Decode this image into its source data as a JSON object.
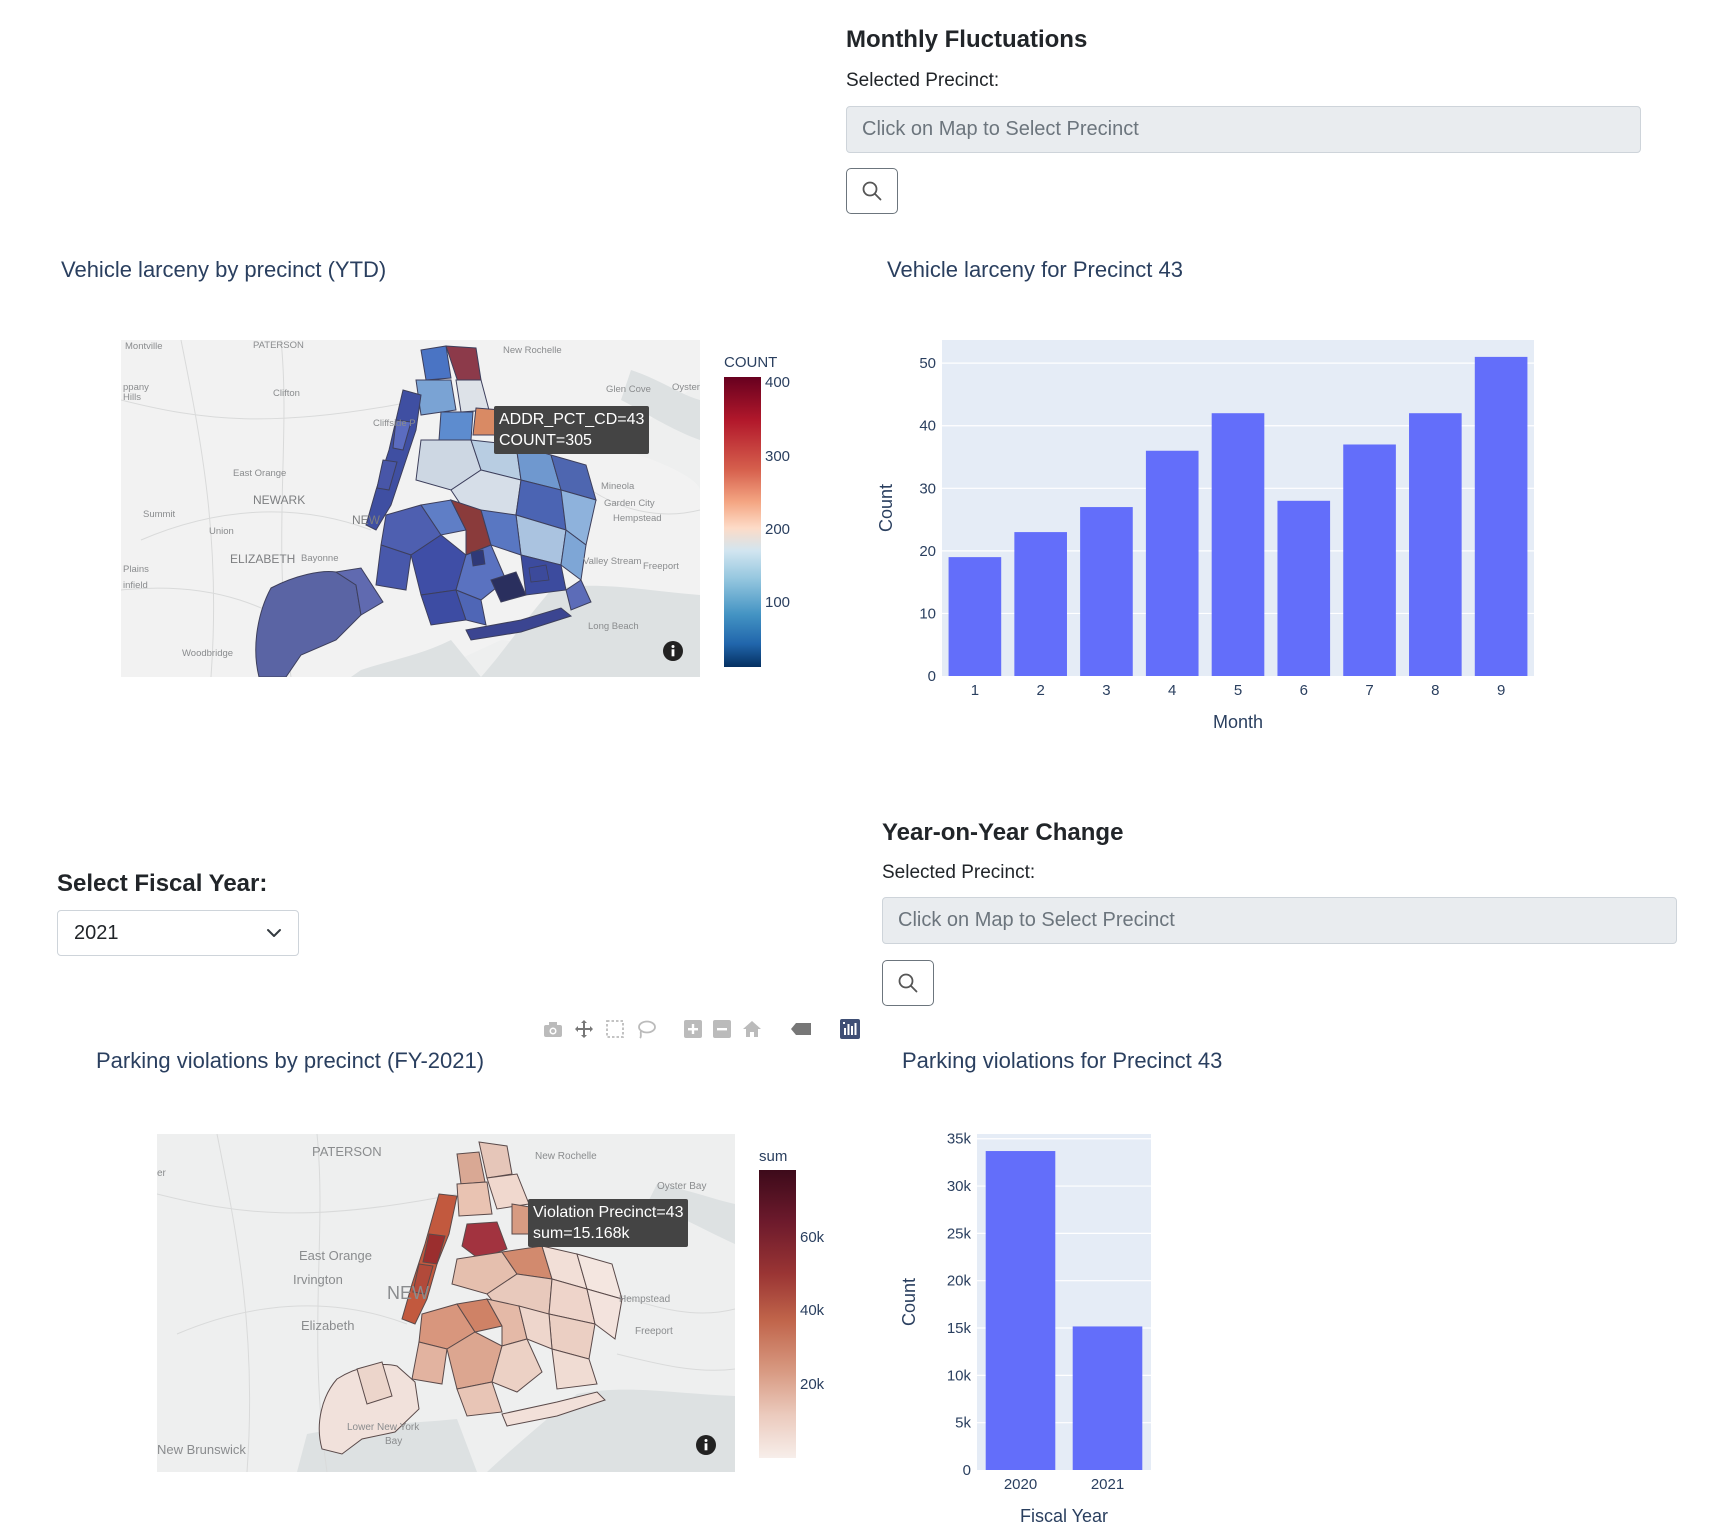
{
  "monthly": {
    "title": "Monthly Fluctuations",
    "label": "Selected Precinct:",
    "placeholder": "Click on Map to Select Precinct"
  },
  "larceny_map": {
    "title": "Vehicle larceny by precinct (YTD)",
    "place_labels": [
      "Montville",
      "PATERSON",
      "New Rochelle",
      "Glen Cove",
      "Oyster",
      "Clifton",
      "Cliffside P",
      "East Orange",
      "NEWARK",
      "NEW",
      "Mineola",
      "Garden City",
      "Hempstead",
      "Summit",
      "Union",
      "ELIZABETH",
      "Bayonne",
      "Valley Stream",
      "Freeport",
      "Long Beach",
      "Woodbridge",
      "Plains",
      "infield",
      "ppany",
      "Hills"
    ],
    "tooltip": [
      "ADDR_PCT_CD=43",
      "COUNT=305"
    ],
    "colorbar": {
      "title": "COUNT",
      "ticks": [
        "400",
        "300",
        "200",
        "100"
      ]
    }
  },
  "larceny_chart": {
    "title": "Vehicle larceny for Precinct 43",
    "chart_data": {
      "type": "bar",
      "categories": [
        "1",
        "2",
        "3",
        "4",
        "5",
        "6",
        "7",
        "8",
        "9"
      ],
      "values": [
        19,
        23,
        27,
        36,
        42,
        28,
        37,
        42,
        51
      ],
      "xlabel": "Month",
      "ylabel": "Count",
      "yticks": [
        "0",
        "10",
        "20",
        "30",
        "40",
        "50"
      ],
      "ylim": [
        0,
        53.7
      ],
      "grid": true,
      "bar_color": "#636efa"
    }
  },
  "fiscal": {
    "label": "Select Fiscal Year:",
    "selected": "2021"
  },
  "yoy": {
    "title": "Year-on-Year Change",
    "label": "Selected Precinct:",
    "placeholder": "Click on Map to Select Precinct"
  },
  "parking_map": {
    "title": "Parking violations by precinct (FY-2021)",
    "place_labels": [
      "PATERSON",
      "New Rochelle",
      "Oyster Bay",
      "East Orange",
      "Irvington",
      "NEW",
      "Elizabeth",
      "Hempstead",
      "Freeport",
      "Lower New York",
      "Bay",
      "New Brunswick",
      "er"
    ],
    "tooltip": [
      "Violation Precinct=43",
      "sum=15.168k"
    ],
    "colorbar": {
      "title": "sum",
      "ticks": [
        "60k",
        "40k",
        "20k"
      ]
    }
  },
  "parking_chart": {
    "title": "Parking violations for Precinct 43",
    "chart_data": {
      "type": "bar",
      "categories": [
        "2020",
        "2021"
      ],
      "values": [
        33700,
        15168
      ],
      "xlabel": "Fiscal Year",
      "ylabel": "Count",
      "yticks": [
        "0",
        "5k",
        "10k",
        "15k",
        "20k",
        "25k",
        "30k",
        "35k"
      ],
      "ylim": [
        0,
        35500
      ],
      "grid": true,
      "bar_color": "#636efa"
    }
  },
  "modebar": [
    "camera-icon",
    "pan-icon",
    "box-select-icon",
    "lasso-icon",
    "zoom-in-icon",
    "zoom-out-icon",
    "home-icon",
    "hover-icon",
    "plotly-logo-icon"
  ],
  "colors": {
    "plot_bg": "#e5ecf6",
    "bar": "#636efa",
    "title": "#2a3f5f",
    "map_bg": "#e7e9e9"
  }
}
